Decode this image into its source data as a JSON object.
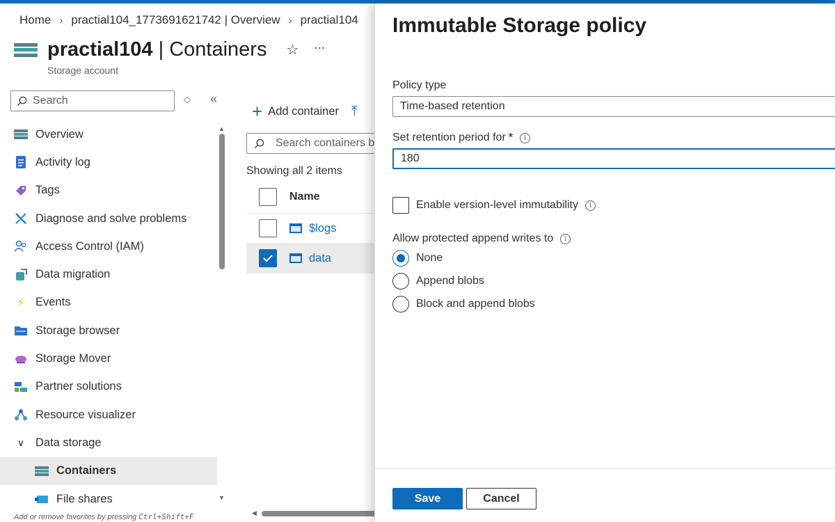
{
  "accent_color": "#0f6cbd",
  "breadcrumb": [
    "Home",
    "practial104_1773691621742 | Overview",
    "practial104"
  ],
  "header": {
    "resource_name": "practial104",
    "page_name": "| Containers",
    "subtitle": "Storage account",
    "favorite_icon": "star-icon",
    "more_icon": "ellipsis-icon"
  },
  "sidebar": {
    "search_placeholder": "Search",
    "items": [
      {
        "label": "Overview",
        "icon": "storage-icon"
      },
      {
        "label": "Activity log",
        "icon": "log-icon"
      },
      {
        "label": "Tags",
        "icon": "tag-icon"
      },
      {
        "label": "Diagnose and solve problems",
        "icon": "wrench-icon"
      },
      {
        "label": "Access Control (IAM)",
        "icon": "people-icon"
      },
      {
        "label": "Data migration",
        "icon": "migration-icon"
      },
      {
        "label": "Events",
        "icon": "lightning-icon"
      },
      {
        "label": "Storage browser",
        "icon": "folder-icon"
      },
      {
        "label": "Storage Mover",
        "icon": "cloud-icon"
      },
      {
        "label": "Partner solutions",
        "icon": "partner-icon"
      },
      {
        "label": "Resource visualizer",
        "icon": "network-icon"
      }
    ],
    "group": {
      "label": "Data storage",
      "expanded": true
    },
    "sub_items": [
      {
        "label": "Containers",
        "active": true
      },
      {
        "label": "File shares",
        "active": false
      }
    ],
    "fav_hint_prefix": "Add or remove favorites by pressing ",
    "fav_hint_keys": "Ctrl+Shift+F"
  },
  "content": {
    "add_container_label": "Add container",
    "search_placeholder": "Search containers by prefix",
    "showing_text": "Showing all 2 items",
    "column_name": "Name",
    "rows": [
      {
        "name": "$logs",
        "checked": false
      },
      {
        "name": "data",
        "checked": true
      }
    ]
  },
  "panel": {
    "title": "Immutable Storage policy",
    "policy_type_label": "Policy type",
    "policy_type_value": "Time-based retention",
    "retention_label": "Set retention period for",
    "retention_required_mark": "*",
    "retention_value": "180",
    "version_immutability_label": "Enable version-level immutability",
    "version_immutability_checked": false,
    "append_label": "Allow protected append writes to",
    "append_options": [
      {
        "label": "None",
        "selected": true
      },
      {
        "label": "Append blobs",
        "selected": false
      },
      {
        "label": "Block and append blobs",
        "selected": false
      }
    ],
    "save_label": "Save",
    "cancel_label": "Cancel"
  }
}
